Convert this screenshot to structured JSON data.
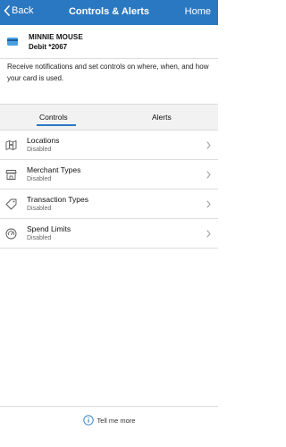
{
  "nav": {
    "back_label": "Back",
    "title": "Controls & Alerts",
    "home_label": "Home"
  },
  "card": {
    "name": "MINNIE MOUSE",
    "number": "Debit *2067",
    "icon": "credit-card-icon"
  },
  "description": "Receive notifications and set controls on where, when, and how your card is used.",
  "tabs": [
    {
      "label": "Controls",
      "selected": true
    },
    {
      "label": "Alerts",
      "selected": false
    }
  ],
  "controls": [
    {
      "title": "Locations",
      "status": "Disabled",
      "icon": "map-icon"
    },
    {
      "title": "Merchant Types",
      "status": "Disabled",
      "icon": "storefront-icon"
    },
    {
      "title": "Transaction Types",
      "status": "Disabled",
      "icon": "tag-icon"
    },
    {
      "title": "Spend Limits",
      "status": "Disabled",
      "icon": "gauge-icon"
    }
  ],
  "footer": {
    "label": "Tell me more",
    "icon": "info-icon"
  },
  "colors": {
    "nav_background": "#2b78c2",
    "accent": "#2b78c2",
    "tab_background": "#f2f2f2"
  }
}
